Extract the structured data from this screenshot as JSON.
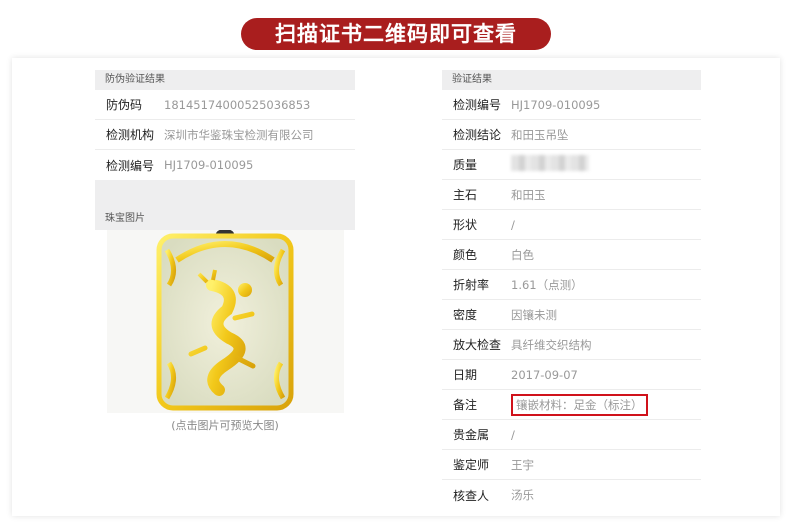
{
  "banner": {
    "text": "扫描证书二维码即可查看"
  },
  "left": {
    "section_title": "防伪验证结果",
    "rows": [
      {
        "label": "防伪码",
        "value": "18145174000525036853"
      },
      {
        "label": "检测机构",
        "value": "深圳市华鉴珠宝检测有限公司"
      },
      {
        "label": "检测编号",
        "value": "HJ1709-010095"
      }
    ],
    "image_section_title": "珠宝图片",
    "image_caption": "(点击图片可预览大图)"
  },
  "right": {
    "section_title": "验证结果",
    "rows": [
      {
        "label": "检测编号",
        "value": "HJ1709-010095"
      },
      {
        "label": "检测结论",
        "value": "和田玉吊坠"
      },
      {
        "label": "质量",
        "value": ""
      },
      {
        "label": "主石",
        "value": "和田玉"
      },
      {
        "label": "形状",
        "value": "/"
      },
      {
        "label": "颜色",
        "value": "白色"
      },
      {
        "label": "折射率",
        "value": "1.61（点测）"
      },
      {
        "label": "密度",
        "value": "因镶未测"
      },
      {
        "label": "放大检查",
        "value": "具纤维交织结构"
      },
      {
        "label": "日期",
        "value": "2017-09-07"
      },
      {
        "label": "备注",
        "value": "镶嵌材料：足金（标注）"
      },
      {
        "label": "贵金属",
        "value": "/"
      },
      {
        "label": "鉴定师",
        "value": "王宇"
      },
      {
        "label": "核查人",
        "value": "汤乐"
      }
    ]
  },
  "colors": {
    "banner": "#a91e1e",
    "highlight_border": "#d0121b"
  }
}
